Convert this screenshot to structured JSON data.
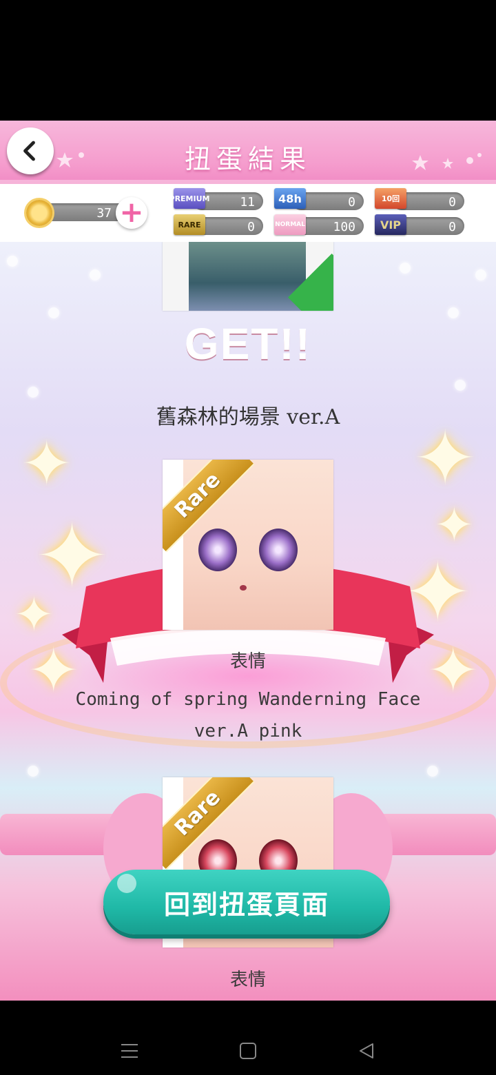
{
  "header": {
    "title": "扭蛋結果"
  },
  "currency": {
    "coins": "37",
    "tickets": [
      {
        "label": "PREMIUM",
        "value": "11",
        "color": "#7b6fd8"
      },
      {
        "label": "48h",
        "value": "0",
        "color": "#3f7fd6"
      },
      {
        "label": "10回",
        "value": "0",
        "color": "#e0603a"
      },
      {
        "label": "RARE",
        "value": "0",
        "color": "#c9a53c"
      },
      {
        "label": "NORMAL",
        "value": "100",
        "color": "#f2a7c9"
      },
      {
        "label": "VIP",
        "value": "0",
        "color": "#3a3c8a"
      }
    ]
  },
  "results": {
    "get_label": "GET!!",
    "first_item_name": "舊森林的場景 ver.A",
    "items": [
      {
        "badge": "Rare",
        "category": "表情",
        "name": "Coming of spring Wanderning Face ver.A pink"
      },
      {
        "badge": "Rare",
        "category": "表情"
      }
    ]
  },
  "actions": {
    "return_label": "回到扭蛋頁面"
  },
  "colors": {
    "header_pink": "#f59ccd",
    "return_teal": "#1fb8a6",
    "ribbon_red": "#e8355a"
  }
}
